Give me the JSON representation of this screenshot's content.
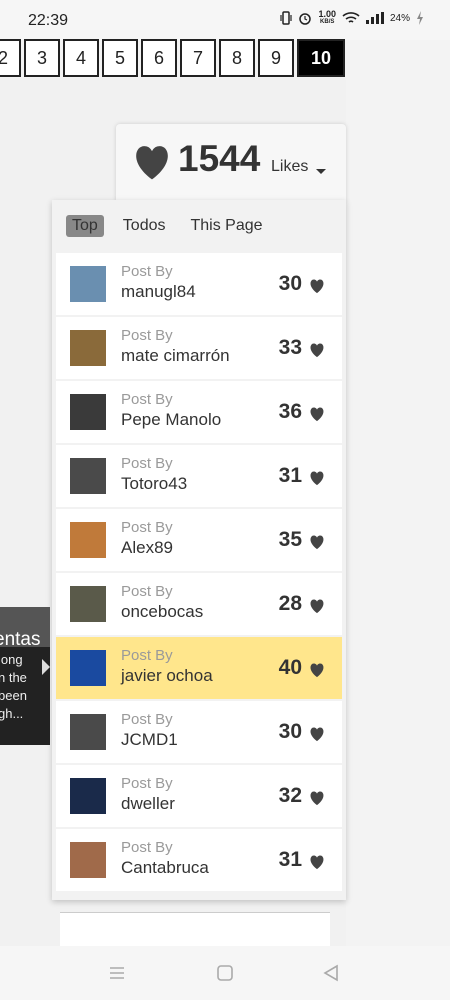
{
  "status_bar": {
    "time": "22:39",
    "net_speed": "1.00",
    "net_unit": "KB/S",
    "battery": "24%",
    "icons": [
      "vibrate-icon",
      "alarm-icon",
      "wifi-icon",
      "signal-icon",
      "battery-charging-icon"
    ]
  },
  "pager": {
    "pages": [
      "2",
      "3",
      "4",
      "5",
      "6",
      "7",
      "8",
      "9",
      "10"
    ],
    "active": "10"
  },
  "likes": {
    "count": "1544",
    "label": "Likes"
  },
  "tabs": [
    "Top",
    "Todos",
    "This Page"
  ],
  "selected_tab": "Top",
  "posts": [
    {
      "by": "Post By",
      "author": "manugl84",
      "likes": "30",
      "avatar_color": "#6a8fb0",
      "highlight": false
    },
    {
      "by": "Post By",
      "author": "mate cimarrón",
      "likes": "33",
      "avatar_color": "#8a6a3a",
      "highlight": false
    },
    {
      "by": "Post By",
      "author": "Pepe Manolo",
      "likes": "36",
      "avatar_color": "#3a3a3a",
      "highlight": false
    },
    {
      "by": "Post By",
      "author": "Totoro43",
      "likes": "31",
      "avatar_color": "#4a4a4a",
      "highlight": false
    },
    {
      "by": "Post By",
      "author": "Alex89",
      "likes": "35",
      "avatar_color": "#c07a3a",
      "highlight": false
    },
    {
      "by": "Post By",
      "author": "oncebocas",
      "likes": "28",
      "avatar_color": "#5a5a4a",
      "highlight": false
    },
    {
      "by": "Post By",
      "author": "javier ochoa",
      "likes": "40",
      "avatar_color": "#1a4aa0",
      "highlight": true
    },
    {
      "by": "Post By",
      "author": "JCMD1",
      "likes": "30",
      "avatar_color": "#4a4a4a",
      "highlight": false
    },
    {
      "by": "Post By",
      "author": "dweller",
      "likes": "32",
      "avatar_color": "#1a2a4a",
      "highlight": false
    },
    {
      "by": "Post By",
      "author": "Cantabruca",
      "likes": "31",
      "avatar_color": "#a06a4a",
      "highlight": false
    }
  ],
  "side_card": {
    "title": "entas",
    "lines": [
      "long",
      "n the",
      "been",
      "gh..."
    ]
  },
  "colors": {
    "highlight": "#ffe68c",
    "heart": "#444444",
    "active_page": "#000000"
  },
  "navbar": [
    "menu-icon",
    "home-icon",
    "back-icon"
  ]
}
